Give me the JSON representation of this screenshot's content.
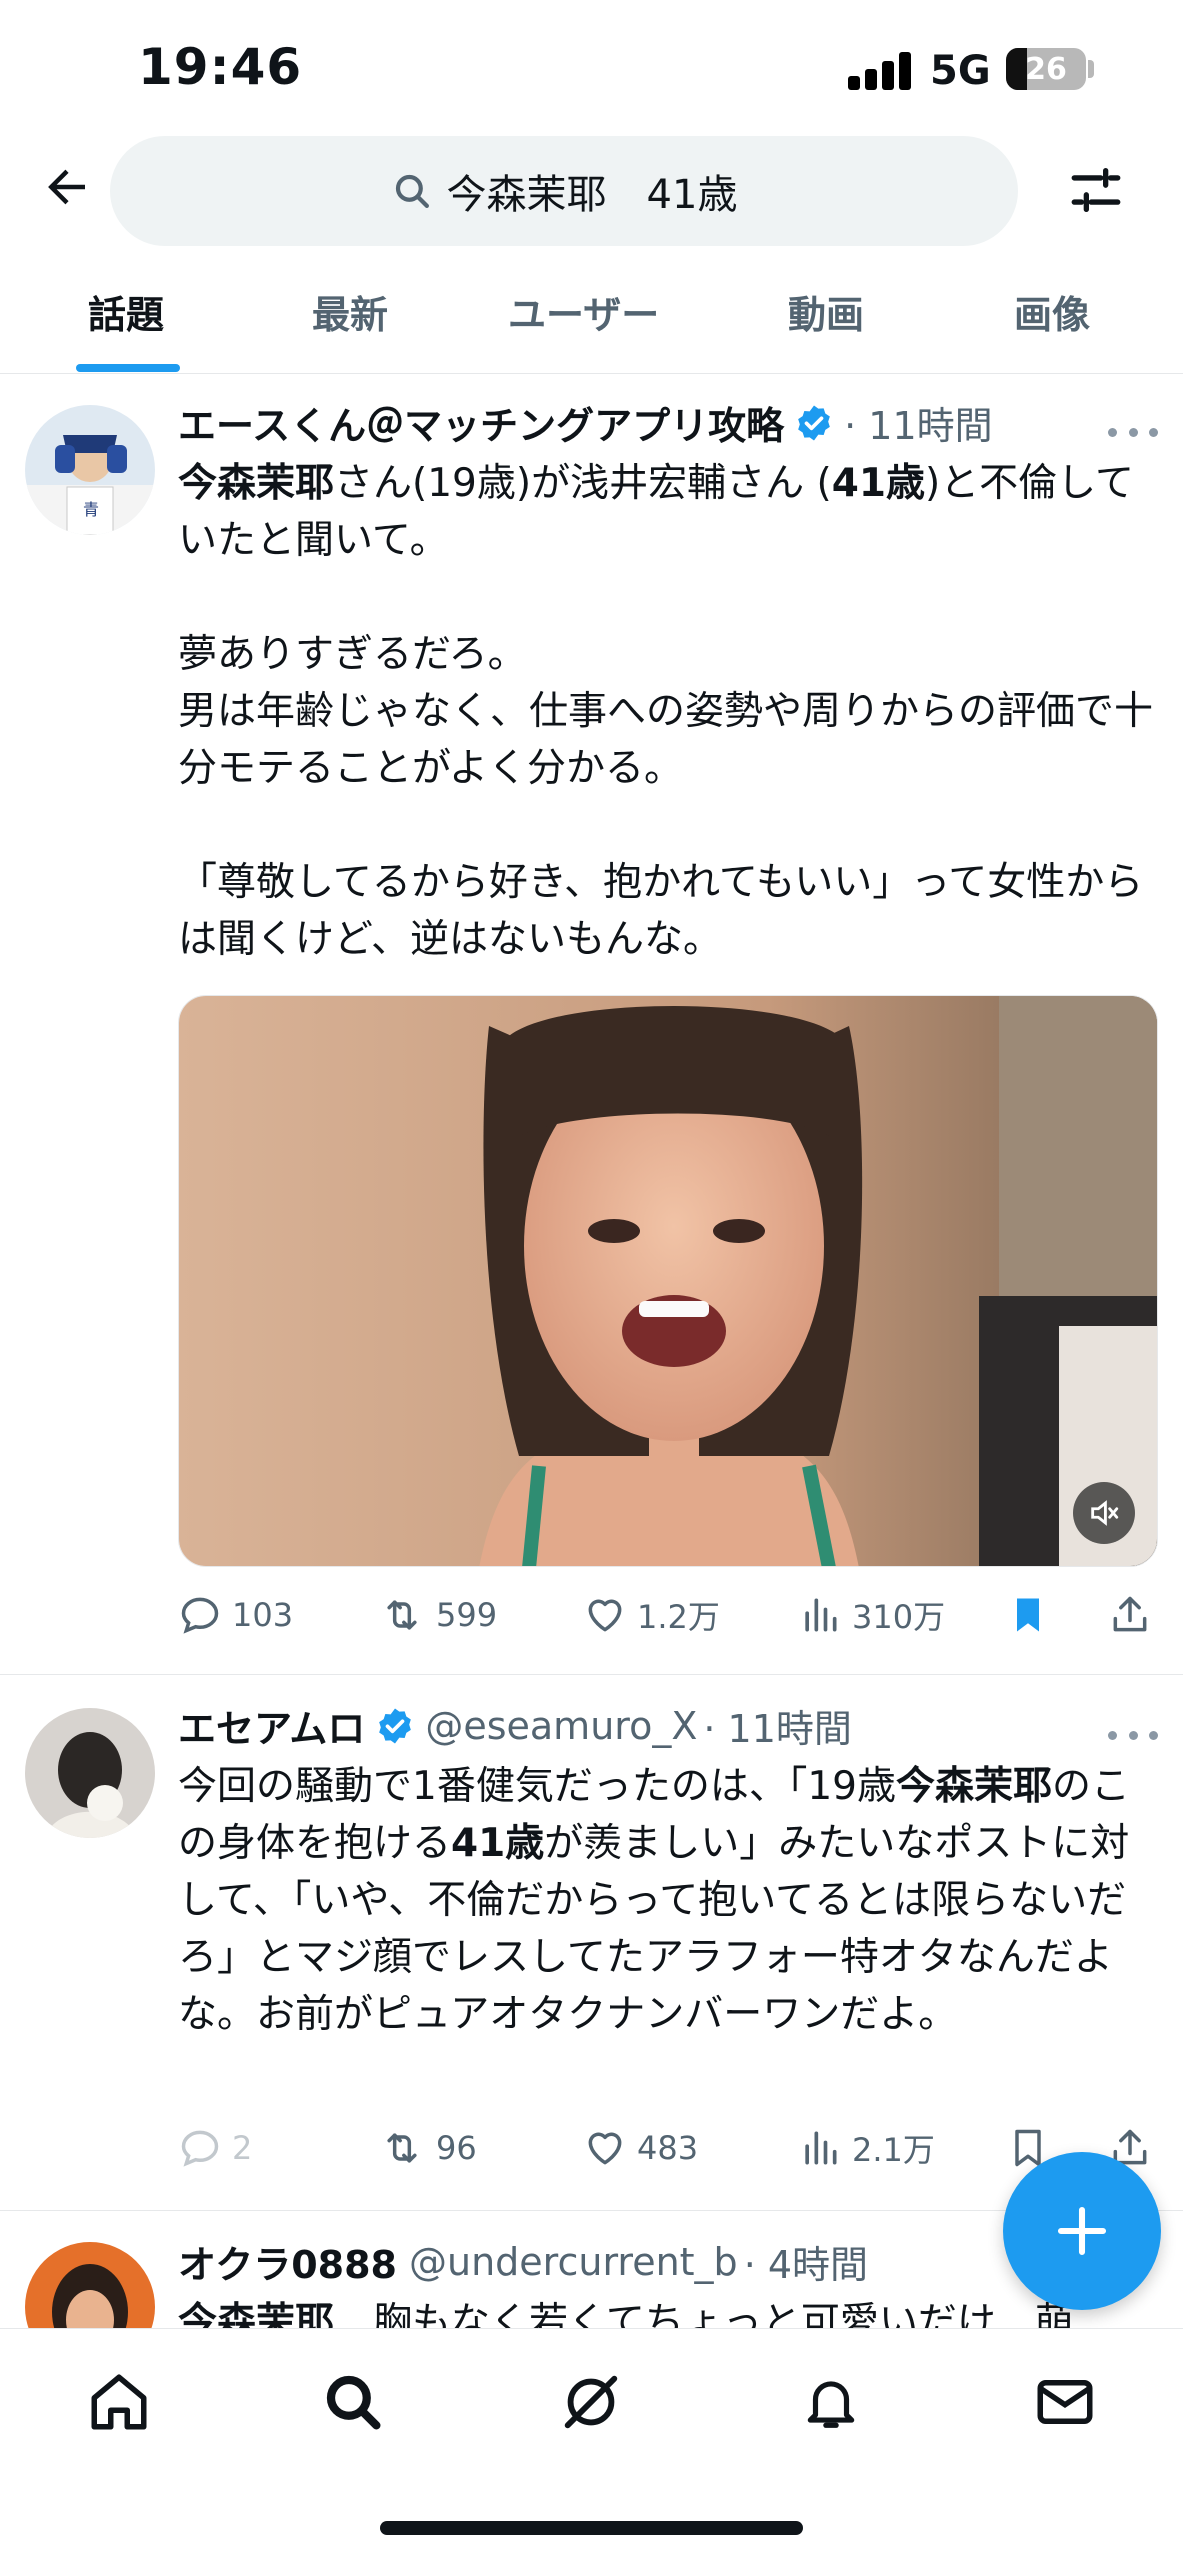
{
  "status_bar": {
    "time": "19:46",
    "network": "5G",
    "battery": "26",
    "battery_level": 0.26
  },
  "search": {
    "query": "今森茉耶　41歳"
  },
  "tabs": [
    {
      "label": "話題"
    },
    {
      "label": "最新"
    },
    {
      "label": "ユーザー"
    },
    {
      "label": "動画"
    },
    {
      "label": "画像"
    }
  ],
  "tweets": [
    {
      "name": "エースくん＠マッチングアプリ攻略",
      "handle": "",
      "time": "· 11時間",
      "text_parts": [
        {
          "t": "今森茉耶",
          "b": true
        },
        {
          "t": "さん(19歳)が浅井宏輔さん (",
          "b": false
        },
        {
          "t": "41歳",
          "b": true
        },
        {
          "t": ")と不倫していたと聞いて。\n\n夢ありすぎるだろ。\n男は年齢じゃなく、仕事への姿勢や周りからの評価で十分モテることがよく分かる。\n\n「尊敬してるから好き、抱かれてもいい」って女性からは聞くけど、逆はないもんな。",
          "b": false
        }
      ],
      "replies": "103",
      "retweets": "599",
      "likes": "1.2万",
      "views": "310万"
    },
    {
      "name": "エセアムロ",
      "handle": "@eseamuro_X",
      "time": "· 11時間",
      "text_parts": [
        {
          "t": "今回の騒動で1番健気だったのは、「19歳",
          "b": false
        },
        {
          "t": "今森茉耶",
          "b": true
        },
        {
          "t": "のこの身体を抱ける",
          "b": false
        },
        {
          "t": "41歳",
          "b": true
        },
        {
          "t": "が羨ましい」みたいなポストに対して、「いや、不倫だからって抱いてるとは限らないだろ」とマジ顔でレスしてたアラフォー特オタなんだよな。お前がピュアオタクナンバーワンだよ。",
          "b": false
        }
      ],
      "replies": "2",
      "retweets": "96",
      "likes": "483",
      "views": "2.1万"
    },
    {
      "name": "オクラ0888",
      "handle": "@undercurrent_b",
      "time": "· 4時間",
      "text_parts": [
        {
          "t": "今森茉耶",
          "b": true
        },
        {
          "t": "　胸もなく若くてちょっと可愛いだけ　萌",
          "b": false
        }
      ]
    }
  ],
  "icons": {
    "back": "arrow-left-icon",
    "search": "search-icon",
    "filter": "sliders-icon",
    "verified": "verified-badge-icon",
    "mute": "speaker-muted-icon",
    "compose": "plus-icon",
    "nav": [
      "home-icon",
      "search-icon",
      "grok-icon",
      "bell-icon",
      "mail-icon"
    ]
  },
  "colors": {
    "accent": "#1d9bf0",
    "text": "#0f1419",
    "secondary": "#536471"
  }
}
